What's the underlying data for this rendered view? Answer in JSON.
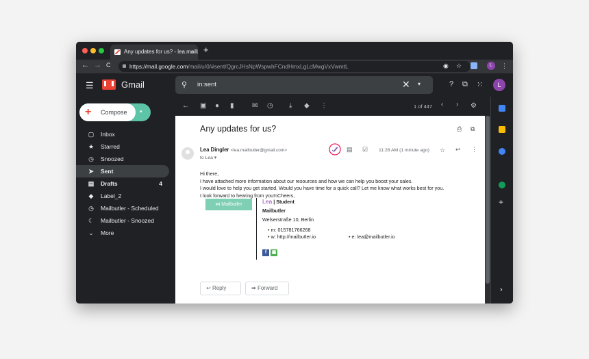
{
  "browser": {
    "tab_title": "Any updates for us? - lea.mailbutle",
    "tab_close": "×",
    "new_tab": "+",
    "url_host": "https://mail.google.com",
    "url_path": "/mail/u/0/#sent/QgrcJHsNpWspwhFCndHmxLgLcMwgVxVwmtL",
    "avatar_letter": "L",
    "back": "←",
    "forward": "→",
    "reload": "C"
  },
  "gmail": {
    "menu_icon": "☰",
    "app_name": "Gmail",
    "search_value": "in:sent",
    "search_clear": "✕",
    "search_options": "▾",
    "avatar_letter": "L"
  },
  "sidebar": {
    "compose_label": "Compose",
    "items": [
      {
        "label": "Inbox",
        "icon": "inbox-icon",
        "glyph": "▢",
        "count": ""
      },
      {
        "label": "Starred",
        "icon": "star-icon",
        "glyph": "★",
        "count": ""
      },
      {
        "label": "Snoozed",
        "icon": "clock-icon",
        "glyph": "◷",
        "count": ""
      },
      {
        "label": "Sent",
        "icon": "send-icon",
        "glyph": "➤",
        "count": ""
      },
      {
        "label": "Drafts",
        "icon": "draft-icon",
        "glyph": "▤",
        "count": "4"
      },
      {
        "label": "Label_2",
        "icon": "label-icon",
        "glyph": "◆",
        "count": ""
      },
      {
        "label": "Mailbutler - Scheduled",
        "icon": "clock-icon",
        "glyph": "◷",
        "count": ""
      },
      {
        "label": "Mailbutler - Snoozed",
        "icon": "moon-icon",
        "glyph": "☾",
        "count": ""
      },
      {
        "label": "More",
        "icon": "chevron-down-icon",
        "glyph": "⌄",
        "count": ""
      }
    ]
  },
  "toolbar": {
    "pagination": "1 of 447",
    "back": "←",
    "prev": "‹",
    "next": "›",
    "settings": "⚙"
  },
  "message": {
    "subject": "Any updates for us?",
    "sender_name": "Lea Dingler",
    "sender_email": "<lea.mailbutler@gmail.com>",
    "to": "to Lea ▾",
    "time": "11:28 AM (1 minute ago)",
    "body_lines": [
      "Hi there,",
      "I have attached more information about our resources and how we can help you boost your sales.",
      "I would love to help you get started. Would you have time for a quick call? Let me know what works best for you.",
      "I look forward to hearing from you!nCheers,"
    ],
    "mailbutler_button": "Mailbutler",
    "signature": {
      "name": "Lea",
      "separator": "|",
      "role": "Student",
      "company": "Mailbutler",
      "address": "Welserstraße 10, Berlin",
      "mobile": "m: 015781766268",
      "web": "w: http://mailbutler.io",
      "email": "e: lea@mailbutler.io"
    },
    "reply_label": "Reply",
    "forward_label": "Forward"
  }
}
